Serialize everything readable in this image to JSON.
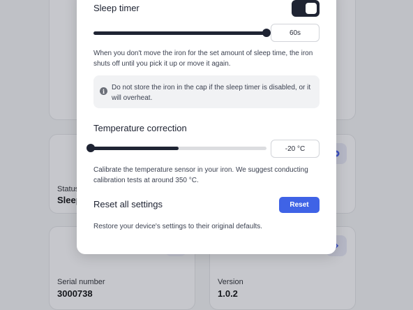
{
  "background": {
    "cards": [
      {
        "label": "Status",
        "value": "Sleep"
      },
      {
        "label": "Serial number",
        "value": "3000738"
      },
      {
        "label": "Version",
        "value": "1.0.2"
      }
    ]
  },
  "modal": {
    "sleep_timer": {
      "title": "Sleep timer",
      "toggle_on": true,
      "slider_fraction": 1.0,
      "value": "60s",
      "description": "When you don't move the iron for the set amount of sleep time, the iron shuts off until you pick it up or move it again.",
      "info": "Do not store the iron in the cap if the sleep timer is disabled, or it will overheat."
    },
    "temperature_correction": {
      "title": "Temperature correction",
      "slider_fraction": 0.5,
      "value": "-20 °C",
      "description": "Calibrate the temperature sensor in your iron. We suggest conducting calibration tests at around 350 °C."
    },
    "reset": {
      "title": "Reset all settings",
      "button_label": "Reset",
      "description": "Restore your device's settings to their original defaults."
    }
  },
  "colors": {
    "accent": "#3f63e6",
    "dark": "#1f2433"
  }
}
